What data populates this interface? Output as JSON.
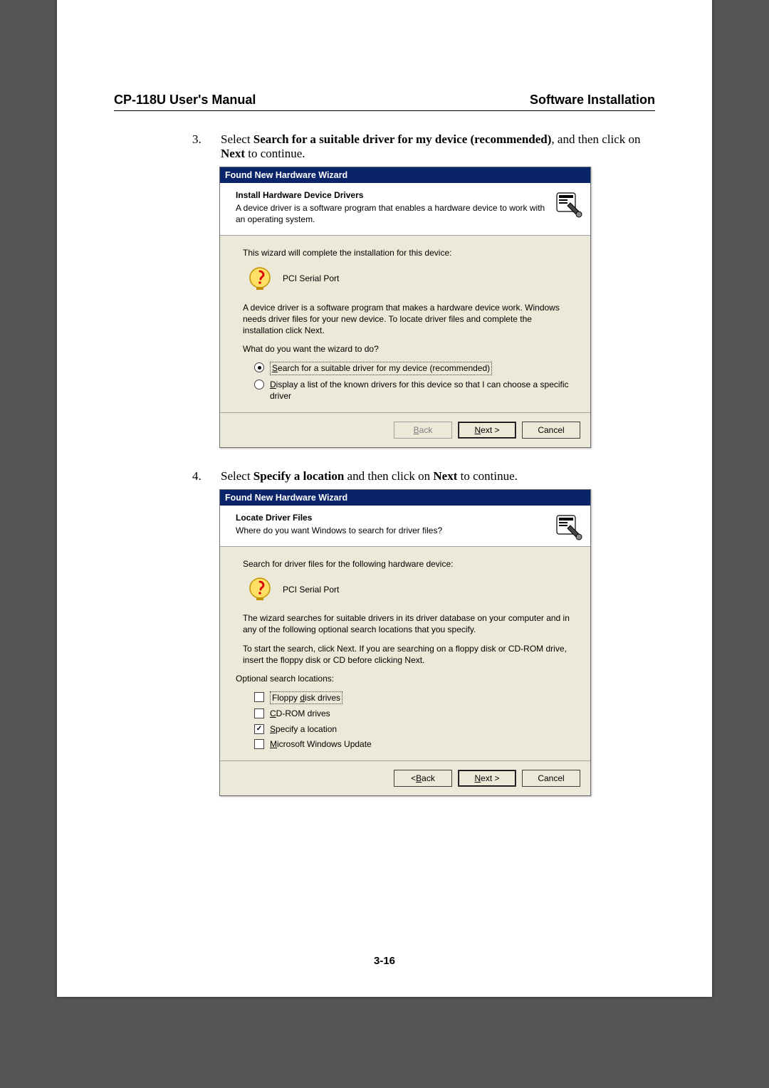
{
  "header": {
    "left": "CP-118U User's Manual",
    "right": "Software Installation"
  },
  "pageNumber": "3-16",
  "step3": {
    "num": "3.",
    "preText": "Select ",
    "bold1": "Search for a suitable driver for my device (recommended)",
    "mid": ", and then click on ",
    "bold2": "Next",
    "after": " to continue."
  },
  "step4": {
    "num": "4.",
    "preText": "Select ",
    "bold1": "Specify a location",
    "mid": " and then click on ",
    "bold2": "Next",
    "after": " to continue."
  },
  "dialog1": {
    "title": "Found New Hardware Wizard",
    "headTitle": "Install Hardware Device Drivers",
    "headSub": "A device driver is a software program that enables a hardware device to work with an operating system.",
    "line1": "This wizard will complete the installation for this device:",
    "device": "PCI Serial Port",
    "line2": "A device driver is a software program that makes a hardware device work. Windows needs driver files for your new device. To locate driver files and complete the installation click Next.",
    "line3": "What do you want the wizard to do?",
    "radioA_u": "S",
    "radioA_rest": "earch for a suitable driver for my device (recommended)",
    "radioB_u": "D",
    "radioB_rest": "isplay a list of the known drivers for this device so that I can choose a specific driver",
    "back": "< Back",
    "next": "Next >",
    "cancel": "Cancel"
  },
  "dialog2": {
    "title": "Found New Hardware Wizard",
    "headTitle": "Locate Driver Files",
    "headSub": "Where do you want Windows to search for driver files?",
    "line1": "Search for driver files for the following hardware device:",
    "device": "PCI Serial Port",
    "line2": "The wizard searches for suitable drivers in its driver database on your computer and in any of the following optional search locations that you specify.",
    "line3": "To start the search, click Next. If you are searching on a floppy disk or CD-ROM drive, insert the floppy disk or CD before clicking Next.",
    "optionalLabel": "Optional search locations:",
    "chk1_pre": "Floppy ",
    "chk1_u": "d",
    "chk1_post": "isk drives",
    "chk2_u": "C",
    "chk2_post": "D-ROM drives",
    "chk3_u": "S",
    "chk3_post": "pecify a location",
    "chk4_u": "M",
    "chk4_post": "icrosoft Windows Update",
    "back": "< Back",
    "next": "Next >",
    "cancel": "Cancel"
  }
}
